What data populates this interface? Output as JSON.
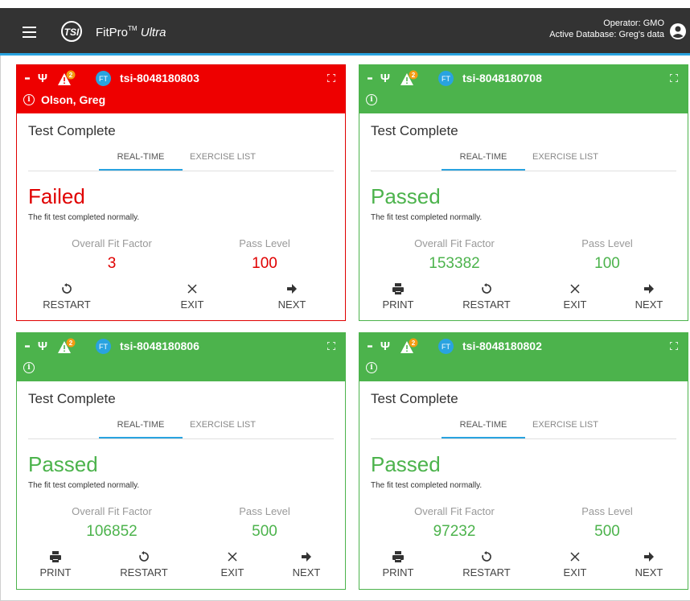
{
  "app": {
    "title": "FitPro",
    "trademark": "TM",
    "subtitle": "Ultra",
    "operator_label": "Operator:",
    "operator": "GMO",
    "database_label": "Active Database:",
    "database": "Greg's data"
  },
  "labels": {
    "tab_realtime": "REAL-TIME",
    "tab_exercise": "EXERCISE LIST",
    "overall_fit_factor": "Overall Fit Factor",
    "pass_level": "Pass Level",
    "print": "PRINT",
    "restart": "RESTART",
    "exit": "EXIT",
    "next": "NEXT",
    "ft_badge": "FT",
    "alert_count": "2"
  },
  "colors": {
    "failed": "#ee0000",
    "passed": "#4cb34c",
    "accent": "#29a3e0",
    "topbar": "#333333"
  },
  "cards": [
    {
      "device": "tsi-8048180803",
      "subject": "Olson, Greg",
      "status_title": "Test Complete",
      "result": "Failed",
      "description": "The fit test completed normally.",
      "fit_factor": "3",
      "pass_level": "100",
      "state": "failed"
    },
    {
      "device": "tsi-8048180708",
      "subject": "",
      "status_title": "Test Complete",
      "result": "Passed",
      "description": "The fit test completed normally.",
      "fit_factor": "153382",
      "pass_level": "100",
      "state": "passed"
    },
    {
      "device": "tsi-8048180806",
      "subject": "",
      "status_title": "Test Complete",
      "result": "Passed",
      "description": "The fit test completed normally.",
      "fit_factor": "106852",
      "pass_level": "500",
      "state": "passed"
    },
    {
      "device": "tsi-8048180802",
      "subject": "",
      "status_title": "Test Complete",
      "result": "Passed",
      "description": "The fit test completed normally.",
      "fit_factor": "97232",
      "pass_level": "500",
      "state": "passed"
    }
  ]
}
